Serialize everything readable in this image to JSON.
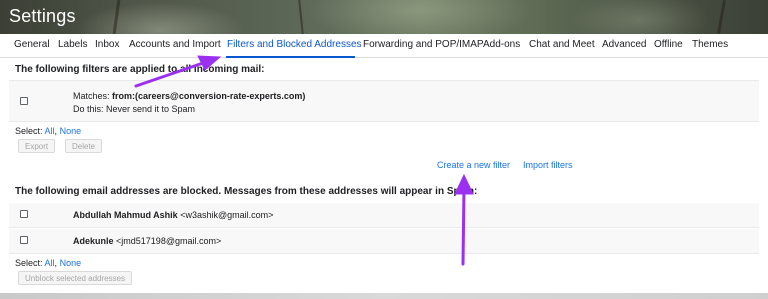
{
  "header": {
    "title": "Settings"
  },
  "tabs": [
    {
      "label": "General"
    },
    {
      "label": "Labels"
    },
    {
      "label": "Inbox"
    },
    {
      "label": "Accounts and Import"
    },
    {
      "label": "Filters and Blocked Addresses"
    },
    {
      "label": "Forwarding and POP/IMAP"
    },
    {
      "label": "Add-ons"
    },
    {
      "label": "Chat and Meet"
    },
    {
      "label": "Advanced"
    },
    {
      "label": "Offline"
    },
    {
      "label": "Themes"
    }
  ],
  "filters": {
    "heading": "The following filters are applied to all incoming mail:",
    "items": [
      {
        "matches_prefix": "Matches: ",
        "matches_value": "from:(careers@conversion-rate-experts.com)",
        "action": "Do this: Never send it to Spam"
      }
    ],
    "select_label": "Select:",
    "select_all": "All",
    "select_separator": ",",
    "select_none": "None",
    "export_label": "Export",
    "delete_label": "Delete",
    "create_filter_label": "Create a new filter",
    "import_filters_label": "Import filters"
  },
  "blocked": {
    "heading": "The following email addresses are blocked. Messages from these addresses will appear in Spam:",
    "items": [
      {
        "name": "Abdullah Mahmud Ashik",
        "email": "<w3ashik@gmail.com>"
      },
      {
        "name": "Adekunle",
        "email": "<jmd517198@gmail.com>"
      }
    ],
    "select_label": "Select:",
    "select_all": "All",
    "select_separator": ",",
    "select_none": "None",
    "unblock_label": "Unblock selected addresses"
  },
  "annotation_color": "#9b30f0"
}
